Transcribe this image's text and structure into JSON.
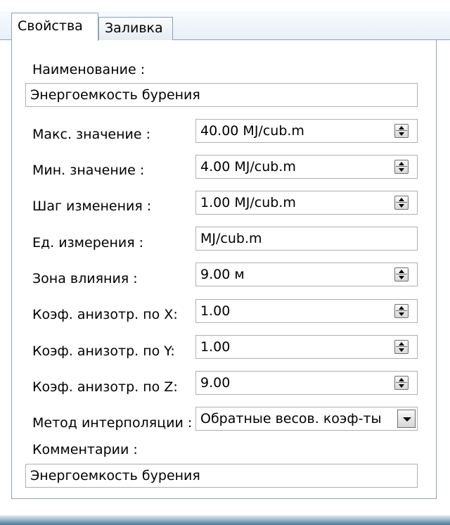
{
  "tabs": [
    {
      "label": "Свойства",
      "active": true
    },
    {
      "label": "Заливка",
      "active": false
    }
  ],
  "name": {
    "label": "Наименование :",
    "value": "Энергоемкость бурения"
  },
  "rows": [
    {
      "label": "Макс. значение :",
      "value": "40.00 MJ/cub.m",
      "spinner": true
    },
    {
      "label": "Мин. значение :",
      "value": "4.00 MJ/cub.m",
      "spinner": true
    },
    {
      "label": "Шаг изменения :",
      "value": "1.00 MJ/cub.m",
      "spinner": true
    },
    {
      "label": "Ед. измерения :",
      "value": "MJ/cub.m",
      "spinner": false
    },
    {
      "label": "Зона влияния :",
      "value": "9.00 м",
      "spinner": true
    },
    {
      "label": "Коэф. анизотр. по X:",
      "value": "1.00",
      "spinner": true
    },
    {
      "label": "Коэф. анизотр. по Y:",
      "value": "1.00",
      "spinner": true
    },
    {
      "label": "Коэф. анизотр. по Z:",
      "value": "9.00",
      "spinner": true
    }
  ],
  "interpolation": {
    "label": "Метод интерполяции :",
    "value": "Обратные весов. коэф-ты"
  },
  "comments": {
    "label": "Комментарии :",
    "value": "Энергоемкость бурения"
  },
  "icons": {
    "spinner": "spin-updown-icon",
    "dropdown": "chevron-down-icon"
  }
}
